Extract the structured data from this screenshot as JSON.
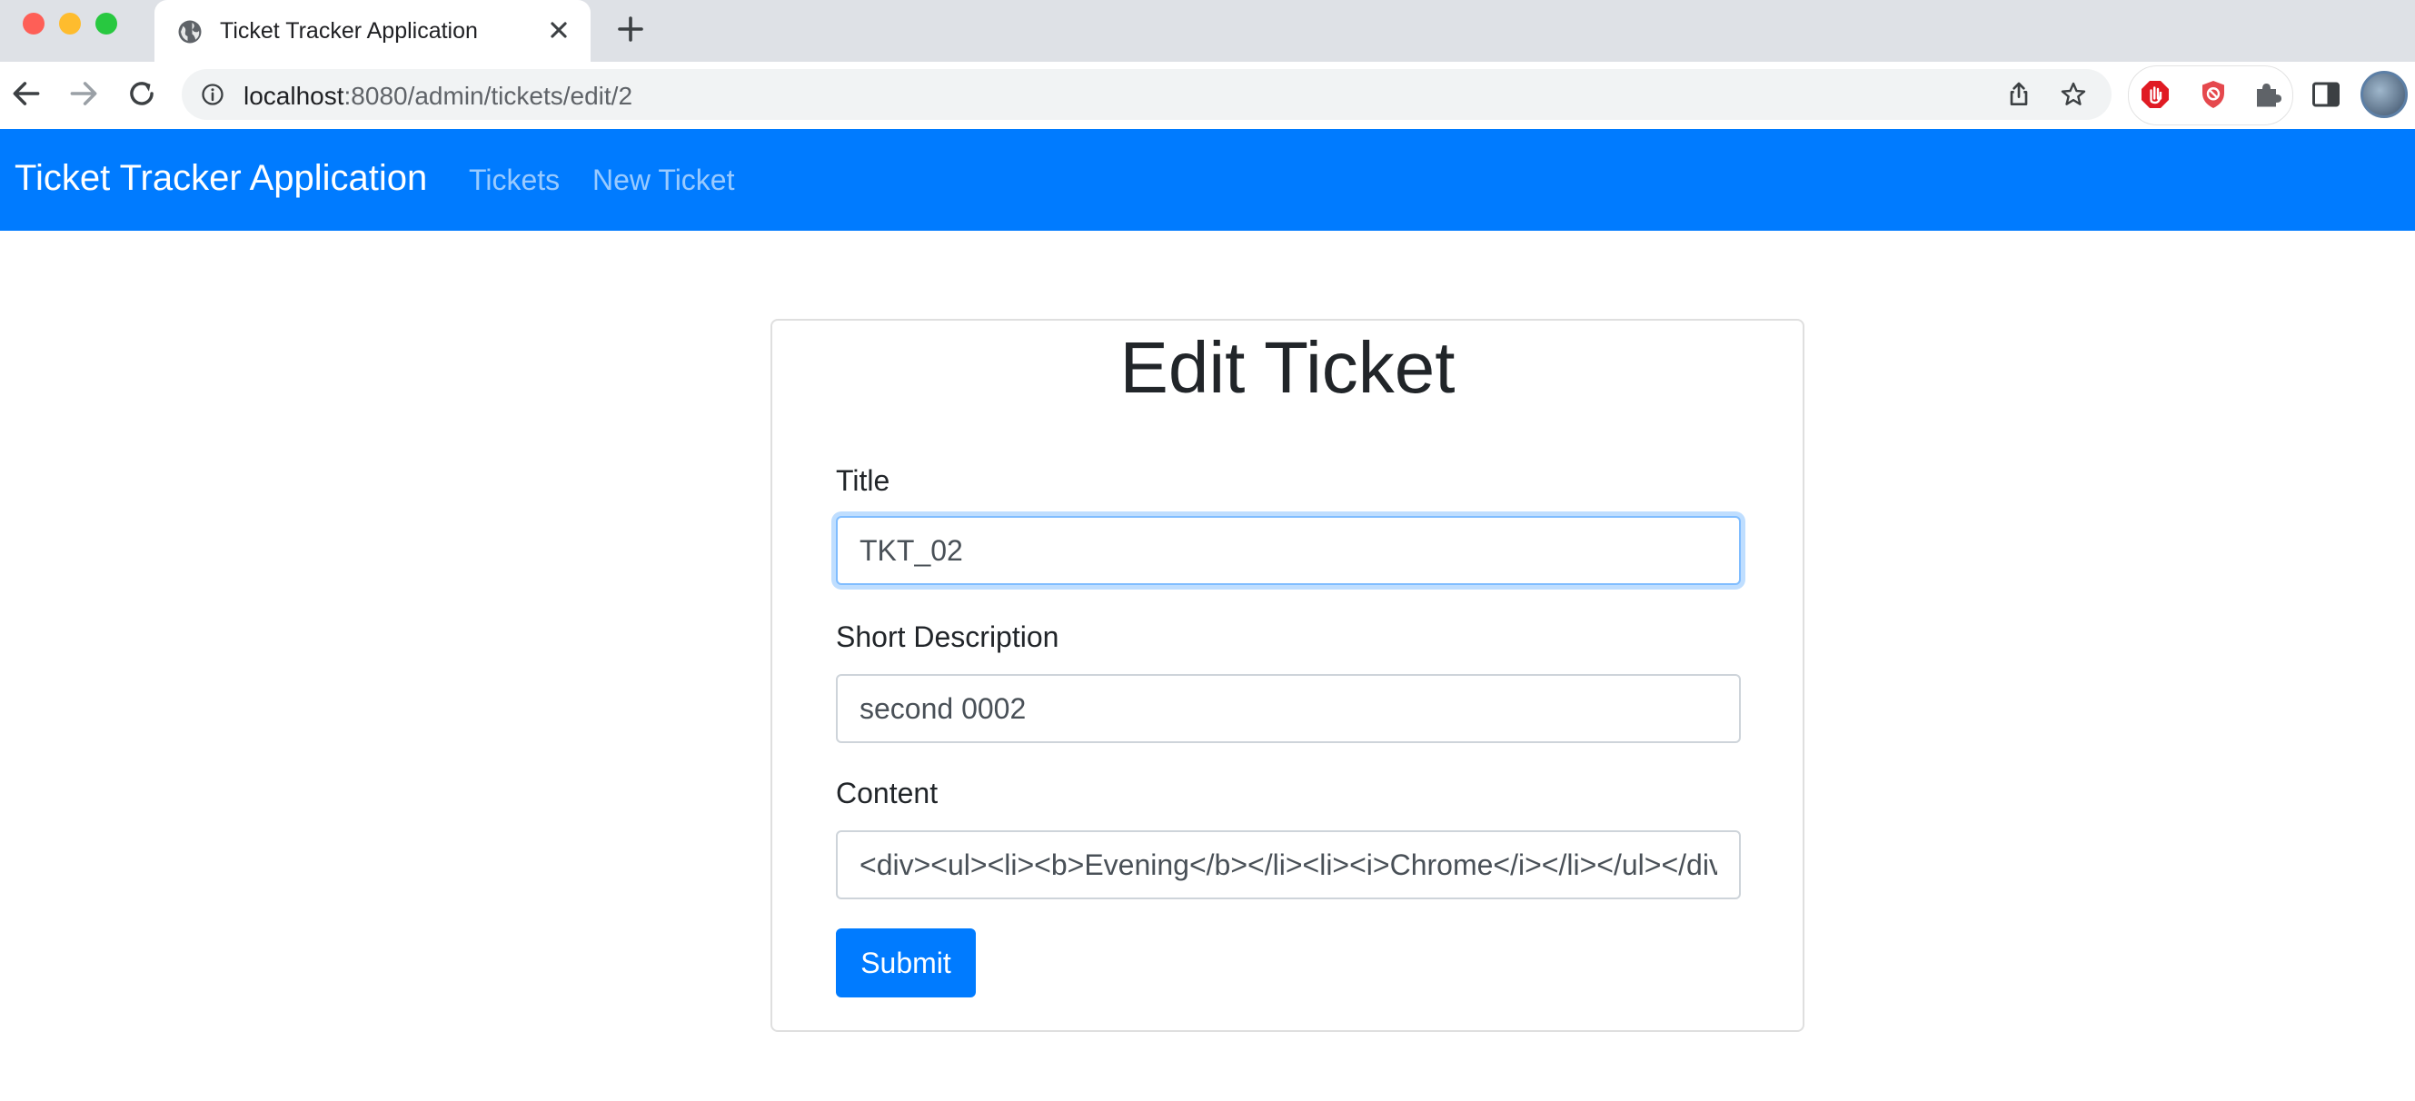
{
  "browser": {
    "tab_title": "Ticket Tracker Application",
    "url_host": "localhost",
    "url_path": ":8080/admin/tickets/edit/2"
  },
  "icons": {
    "tab_favicon": "globe-icon",
    "tab_close": "close-icon",
    "new_tab": "plus-icon",
    "back": "arrow-left-icon",
    "forward": "arrow-right-icon",
    "reload": "reload-icon",
    "site_info": "info-icon",
    "share": "share-icon",
    "bookmark": "star-icon",
    "extension_1": "stop-hand-icon",
    "extension_2": "shield-block-icon",
    "extensions_menu": "puzzle-icon",
    "side_panel": "side-panel-icon",
    "profile": "avatar"
  },
  "navbar": {
    "brand": "Ticket Tracker Application",
    "links": [
      "Tickets",
      "New Ticket"
    ]
  },
  "form": {
    "heading": "Edit Ticket",
    "fields": {
      "title": {
        "label": "Title",
        "value": "TKT_02"
      },
      "short_description": {
        "label": "Short Description",
        "value": "second 0002"
      },
      "content": {
        "label": "Content",
        "value": "<div><ul><li><b>Evening</b></li><li><i>Chrome</i></li></ul></div>"
      }
    },
    "submit_label": "Submit"
  },
  "colors": {
    "navbar_bg": "#007bff",
    "primary_button": "#007bff",
    "tabbar_bg": "#dee1e6",
    "focus_ring": "#80bdff"
  }
}
